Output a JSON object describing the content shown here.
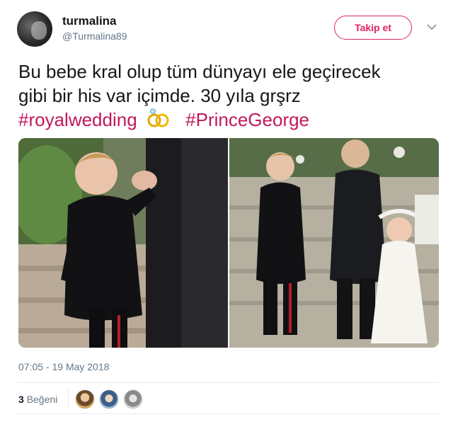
{
  "header": {
    "display_name": "turmalina",
    "handle": "@Turmalina89",
    "follow_label": "Takip et",
    "avatar_icon": "user-avatar",
    "menu_icon": "chevron-down-icon"
  },
  "tweet": {
    "line1": "Bu bebe kral olup tüm dünyayı ele geçirecek",
    "line2": "gibi bir his var içimde. 30 yıla grşrz",
    "hashtag1": "#royalwedding",
    "hashtag2": "#PrinceGeorge",
    "emoji_icon": "wedding-rings-icon"
  },
  "media": {
    "photo_left_subject": "child-in-black-coat-photo",
    "photo_right_subject": "children-on-steps-photo"
  },
  "meta": {
    "timestamp": "07:05 - 19 May 2018",
    "like_count": "3",
    "like_label": "Beğeni"
  },
  "colors": {
    "accent": "#e0245e",
    "hashtag": "#c2185b",
    "muted": "#657786",
    "text": "#14171a"
  }
}
